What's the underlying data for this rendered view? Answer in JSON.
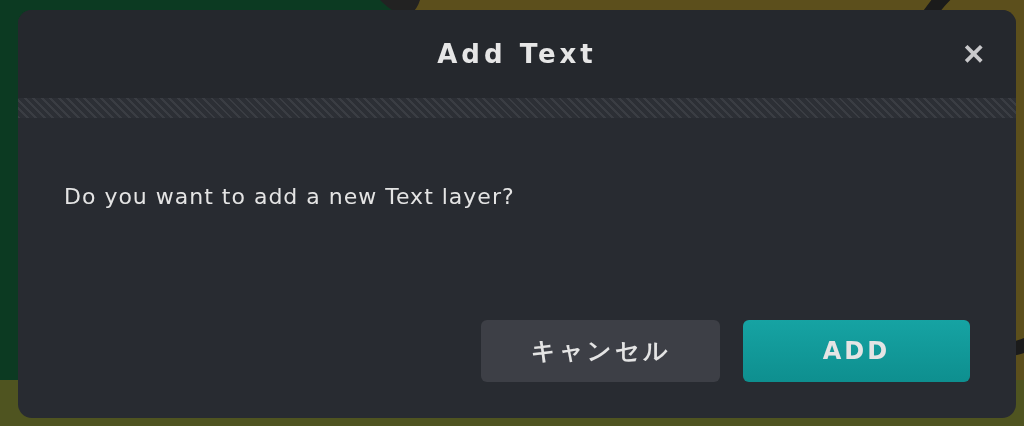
{
  "dialog": {
    "title": "Add Text",
    "close": "✕",
    "message": "Do you want to add a new Text layer?",
    "buttons": [
      {
        "label": "キャンセル",
        "kind": "secondary"
      },
      {
        "label": "ADD",
        "kind": "primary"
      }
    ]
  }
}
